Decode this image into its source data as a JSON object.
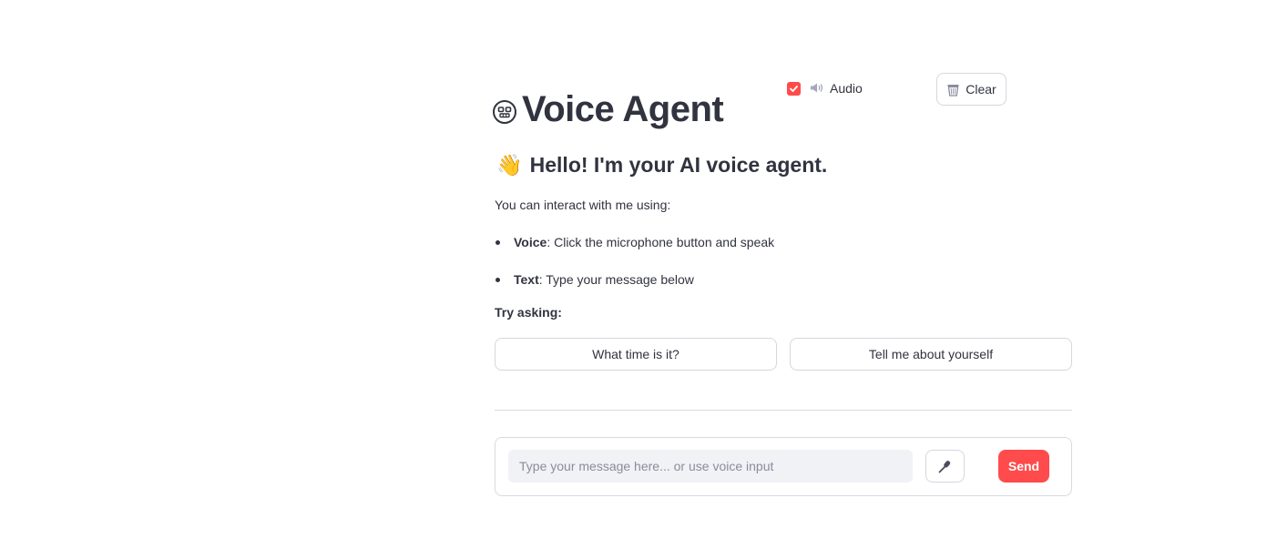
{
  "header": {
    "title": "Voice Agent",
    "title_icon": "robot-face-icon",
    "audio_toggle": {
      "label": "Audio",
      "checked": true,
      "icon": "speaker-icon"
    },
    "clear_button": {
      "label": "Clear",
      "icon": "trash-icon"
    }
  },
  "welcome": {
    "greeting_icon": "👋",
    "greeting": "Hello! I'm your AI voice agent.",
    "intro": "You can interact with me using:",
    "options": [
      {
        "name": "Voice",
        "description": ": Click the microphone button and speak"
      },
      {
        "name": "Text",
        "description": ": Type your message below"
      }
    ],
    "try_asking": "Try asking:",
    "suggestions": [
      "What time is it?",
      "Tell me about yourself"
    ]
  },
  "composer": {
    "placeholder": "Type your message here... or use voice input",
    "value": "",
    "mic_icon": "microphone-icon",
    "send_label": "Send"
  },
  "colors": {
    "accent": "#ff4b4b",
    "text": "#31333f",
    "border": "#d5d7dd",
    "input_bg": "#f0f2f6"
  }
}
